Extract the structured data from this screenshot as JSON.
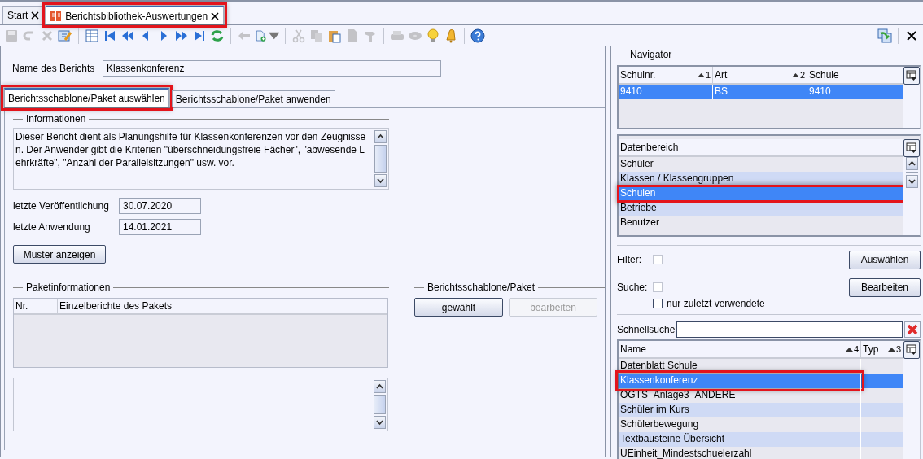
{
  "doc_tabs": [
    {
      "label": "Start",
      "selected": false,
      "highlighted": false
    },
    {
      "label": "Berichtsbibliothek-Auswertungen",
      "selected": true,
      "highlighted": true
    }
  ],
  "toolbar": [
    {
      "kind": "save",
      "disabled": true
    },
    {
      "kind": "undo",
      "disabled": true
    },
    {
      "kind": "delete",
      "disabled": true
    },
    {
      "kind": "edit",
      "disabled": false
    },
    {
      "kind": "separator"
    },
    {
      "kind": "table",
      "disabled": false
    },
    {
      "kind": "first",
      "disabled": false
    },
    {
      "kind": "prev-page",
      "disabled": false
    },
    {
      "kind": "prev",
      "disabled": false
    },
    {
      "kind": "next",
      "disabled": false
    },
    {
      "kind": "next-page",
      "disabled": false
    },
    {
      "kind": "last",
      "disabled": false
    },
    {
      "kind": "refresh",
      "disabled": false
    },
    {
      "kind": "separator"
    },
    {
      "kind": "back",
      "disabled": true
    },
    {
      "kind": "new",
      "disabled": false
    },
    {
      "kind": "separator"
    },
    {
      "kind": "cut",
      "disabled": true
    },
    {
      "kind": "copy",
      "disabled": true
    },
    {
      "kind": "paste",
      "disabled": false
    },
    {
      "kind": "doc",
      "disabled": true
    },
    {
      "kind": "stamp",
      "disabled": true
    },
    {
      "kind": "separator"
    },
    {
      "kind": "print",
      "disabled": true
    },
    {
      "kind": "disc",
      "disabled": true
    },
    {
      "kind": "bulb",
      "disabled": false
    },
    {
      "kind": "bell",
      "disabled": false
    },
    {
      "kind": "separator"
    },
    {
      "kind": "help",
      "disabled": false
    }
  ],
  "toolbar_right": [
    {
      "kind": "exchange"
    },
    {
      "kind": "close"
    }
  ],
  "report": {
    "name_label": "Name des Berichts",
    "name_value": "Klassenkonferenz",
    "tabs": [
      {
        "label": "Berichtsschablone/Paket auswählen",
        "selected": true,
        "highlighted": true
      },
      {
        "label": "Berichtsschablone/Paket anwenden",
        "selected": false,
        "highlighted": false
      }
    ],
    "info_title": "Informationen",
    "description": "Dieser Bericht dient als Planungshilfe für Klassenkonferenzen vor den Zeugnissen. Der Anwender gibt die Kriterien \"überschneidungsfreie Fächer\", \"abwesende Lehrkräfte\", \"Anzahl der Parallelsitzungen\" usw. vor.",
    "fields": [
      {
        "label": "letzte Veröffentlichung",
        "value": "30.07.2020"
      },
      {
        "label": "letzte Anwendung",
        "value": "14.01.2021"
      }
    ],
    "sample_button": "Muster anzeigen",
    "package_title": "Paketinformationen",
    "package_columns": [
      "Nr.",
      "Einzelberichte des Pakets"
    ],
    "template_title": "Berichtsschablone/Paket",
    "template_buttons": [
      {
        "label": "gewählt",
        "disabled": false
      },
      {
        "label": "bearbeiten",
        "disabled": true
      }
    ]
  },
  "navigator": {
    "title": "Navigator",
    "columns": [
      {
        "label": "Schulnr.",
        "sort": "1"
      },
      {
        "label": "Art",
        "sort": "2"
      },
      {
        "label": "Schule"
      }
    ],
    "rows": [
      {
        "cells": [
          "9410",
          "BS",
          "9410"
        ],
        "selected": true
      }
    ],
    "data_area": {
      "column": "Datenbereich",
      "items": [
        {
          "label": "Schüler",
          "selected": false,
          "highlighted": false
        },
        {
          "label": "Klassen / Klassengruppen",
          "selected": false,
          "highlighted": false
        },
        {
          "label": "Schulen",
          "selected": true,
          "highlighted": true
        },
        {
          "label": "Betriebe",
          "selected": false,
          "highlighted": false
        },
        {
          "label": "Benutzer",
          "selected": false,
          "highlighted": false
        }
      ]
    }
  },
  "filter": {
    "label": "Filter:",
    "checked": false
  },
  "search": {
    "label": "Suche:",
    "checked": false
  },
  "recent": {
    "label": "nur zuletzt verwendete",
    "checked": false
  },
  "side_buttons": [
    "Auswählen",
    "Bearbeiten"
  ],
  "quick_search": {
    "label": "Schnellsuche"
  },
  "reports": {
    "columns": [
      {
        "label": "Name",
        "sort": "4"
      },
      {
        "label": "Typ",
        "sort": "3"
      }
    ],
    "rows": [
      {
        "name": "Datenblatt Schule",
        "selected": false,
        "highlighted": false
      },
      {
        "name": "Klassenkonferenz",
        "selected": true,
        "highlighted": true
      },
      {
        "name": "OGTS_Anlage3_ANDERE",
        "selected": false,
        "highlighted": false
      },
      {
        "name": "Schüler im Kurs",
        "selected": false,
        "highlighted": false
      },
      {
        "name": "Schülerbewegung",
        "selected": false,
        "highlighted": false
      },
      {
        "name": "Textbausteine Übersicht",
        "selected": false,
        "highlighted": false
      },
      {
        "name": "UEinheit_Mindestschuelerzahl",
        "selected": false,
        "highlighted": false
      }
    ]
  }
}
